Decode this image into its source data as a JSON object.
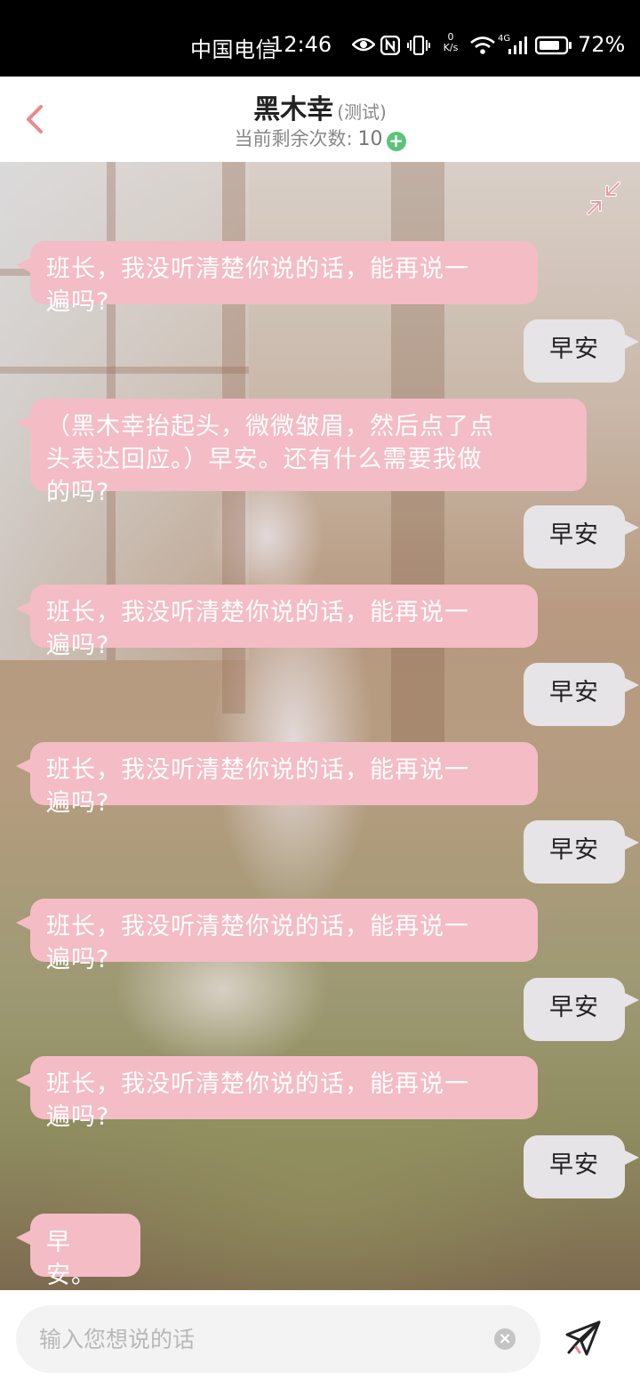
{
  "status": {
    "carrier": "中国电信",
    "time": "12:46",
    "speed_value": "0",
    "speed_unit": "K/s",
    "network": "4G",
    "battery": "72%"
  },
  "header": {
    "title": "黑木幸",
    "tag": "(测试)",
    "remaining_label": "当前剩余次数:",
    "remaining_value": "10"
  },
  "messages": [
    {
      "from": "bot",
      "lines": [
        "班长，我没听清楚你说的话，能再说一",
        "遍吗?"
      ]
    },
    {
      "from": "user",
      "text": "早安"
    },
    {
      "from": "bot",
      "lines": [
        "（黑木幸抬起头，微微皱眉，然后点了点",
        "头表达回应。）早安。还有什么需要我做",
        "的吗?"
      ]
    },
    {
      "from": "user",
      "text": "早安"
    },
    {
      "from": "bot",
      "lines": [
        "班长，我没听清楚你说的话，能再说一",
        "遍吗?"
      ]
    },
    {
      "from": "user",
      "text": "早安"
    },
    {
      "from": "bot",
      "lines": [
        "班长，我没听清楚你说的话，能再说一",
        "遍吗?"
      ]
    },
    {
      "from": "user",
      "text": "早安"
    },
    {
      "from": "bot",
      "lines": [
        "班长，我没听清楚你说的话，能再说一",
        "遍吗?"
      ]
    },
    {
      "from": "user",
      "text": "早安"
    },
    {
      "from": "bot",
      "lines": [
        "班长，我没听清楚你说的话，能再说一",
        "遍吗?"
      ]
    },
    {
      "from": "user",
      "text": "早安"
    },
    {
      "from": "bot",
      "lines": [
        "早",
        "安。"
      ]
    }
  ],
  "input": {
    "placeholder": "输入您想说的话",
    "value": ""
  },
  "colors": {
    "bot_bubble": "#f4bcc4",
    "user_bubble": "#e6e4e6",
    "back_arrow": "#e88a8a",
    "plus": "#5bc37a"
  },
  "icons": [
    "back-arrow-icon",
    "plus-icon",
    "collapse-icon",
    "clear-icon",
    "send-icon"
  ]
}
